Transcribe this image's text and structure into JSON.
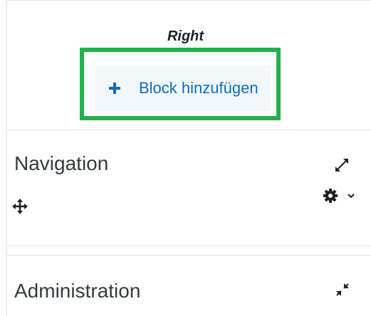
{
  "region": {
    "heading": "Right"
  },
  "add_block": {
    "label": "Block hinzufügen",
    "icon": "plus-icon",
    "highlight_color": "#22b14c",
    "text_color": "#0f6cbf"
  },
  "blocks": [
    {
      "title": "Navigation",
      "controls": [
        "expand-icon",
        "move-icon",
        "gear-icon",
        "chevron-down-icon"
      ]
    },
    {
      "title": "Administration",
      "controls": [
        "collapse-icon"
      ]
    }
  ]
}
